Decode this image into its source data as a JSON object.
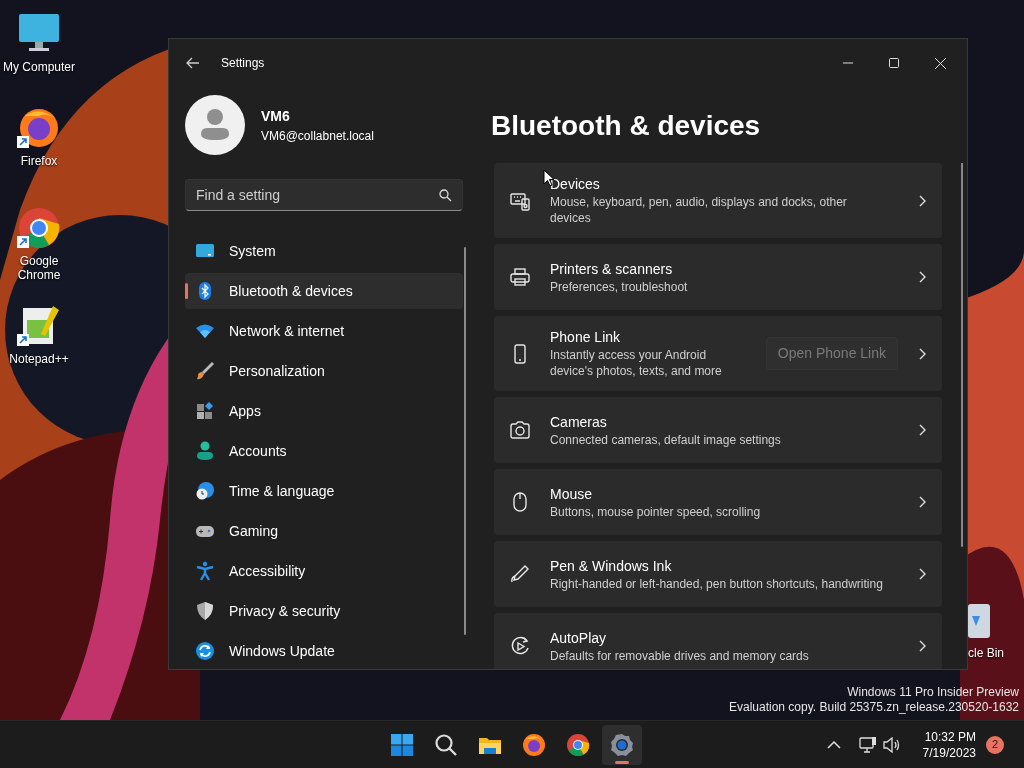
{
  "desktop": {
    "icons": [
      {
        "kind": "computer",
        "label": "My Computer",
        "shortcut": false
      },
      {
        "kind": "firefox",
        "label": "Firefox",
        "shortcut": true
      },
      {
        "kind": "chrome",
        "label": "Google Chrome",
        "shortcut": true
      },
      {
        "kind": "notepad",
        "label": "Notepad++",
        "shortcut": true
      },
      {
        "kind": "recycle",
        "label": "cle Bin",
        "shortcut": false
      }
    ],
    "os_notice": [
      "Windows 11 Pro Insider Preview",
      "Evaluation copy. Build 25375.zn_release.230520-1632"
    ]
  },
  "window": {
    "title": "Settings",
    "user": {
      "name": "VM6",
      "email": "VM6@collabnet.local"
    },
    "search": {
      "placeholder": "Find a setting"
    },
    "nav": [
      {
        "kind": "system",
        "label": "System",
        "selected": false
      },
      {
        "kind": "bluetooth",
        "label": "Bluetooth & devices",
        "selected": true
      },
      {
        "kind": "network",
        "label": "Network & internet",
        "selected": false
      },
      {
        "kind": "personalization",
        "label": "Personalization",
        "selected": false
      },
      {
        "kind": "apps",
        "label": "Apps",
        "selected": false
      },
      {
        "kind": "accounts",
        "label": "Accounts",
        "selected": false
      },
      {
        "kind": "time",
        "label": "Time & language",
        "selected": false
      },
      {
        "kind": "gaming",
        "label": "Gaming",
        "selected": false
      },
      {
        "kind": "accessibility",
        "label": "Accessibility",
        "selected": false
      },
      {
        "kind": "privacy",
        "label": "Privacy & security",
        "selected": false
      },
      {
        "kind": "update",
        "label": "Windows Update",
        "selected": false
      }
    ],
    "page_title": "Bluetooth & devices",
    "cards": [
      {
        "kind": "devices",
        "title": "Devices",
        "description": "Mouse, keyboard, pen, audio, displays and docks, other devices"
      },
      {
        "kind": "printer",
        "title": "Printers & scanners",
        "description": "Preferences, troubleshoot"
      },
      {
        "kind": "phone",
        "title": "Phone Link",
        "description": "Instantly access your Android device's photos, texts, and more",
        "button": {
          "label": "Open Phone Link",
          "disabled": true
        }
      },
      {
        "kind": "camera",
        "title": "Cameras",
        "description": "Connected cameras, default image settings"
      },
      {
        "kind": "mouse",
        "title": "Mouse",
        "description": "Buttons, mouse pointer speed, scrolling"
      },
      {
        "kind": "pen",
        "title": "Pen & Windows Ink",
        "description": "Right-handed or left-handed, pen button shortcuts, handwriting"
      },
      {
        "kind": "autoplay",
        "title": "AutoPlay",
        "description": "Defaults for removable drives and memory cards"
      }
    ]
  },
  "taskbar": {
    "apps": [
      {
        "kind": "start",
        "selected": false
      },
      {
        "kind": "search",
        "selected": false
      },
      {
        "kind": "explorer",
        "selected": false
      },
      {
        "kind": "firefox",
        "selected": false
      },
      {
        "kind": "chrome",
        "selected": false
      },
      {
        "kind": "settings",
        "selected": true
      }
    ],
    "time": "10:32 PM",
    "date": "7/19/2023",
    "notifications": "2"
  }
}
